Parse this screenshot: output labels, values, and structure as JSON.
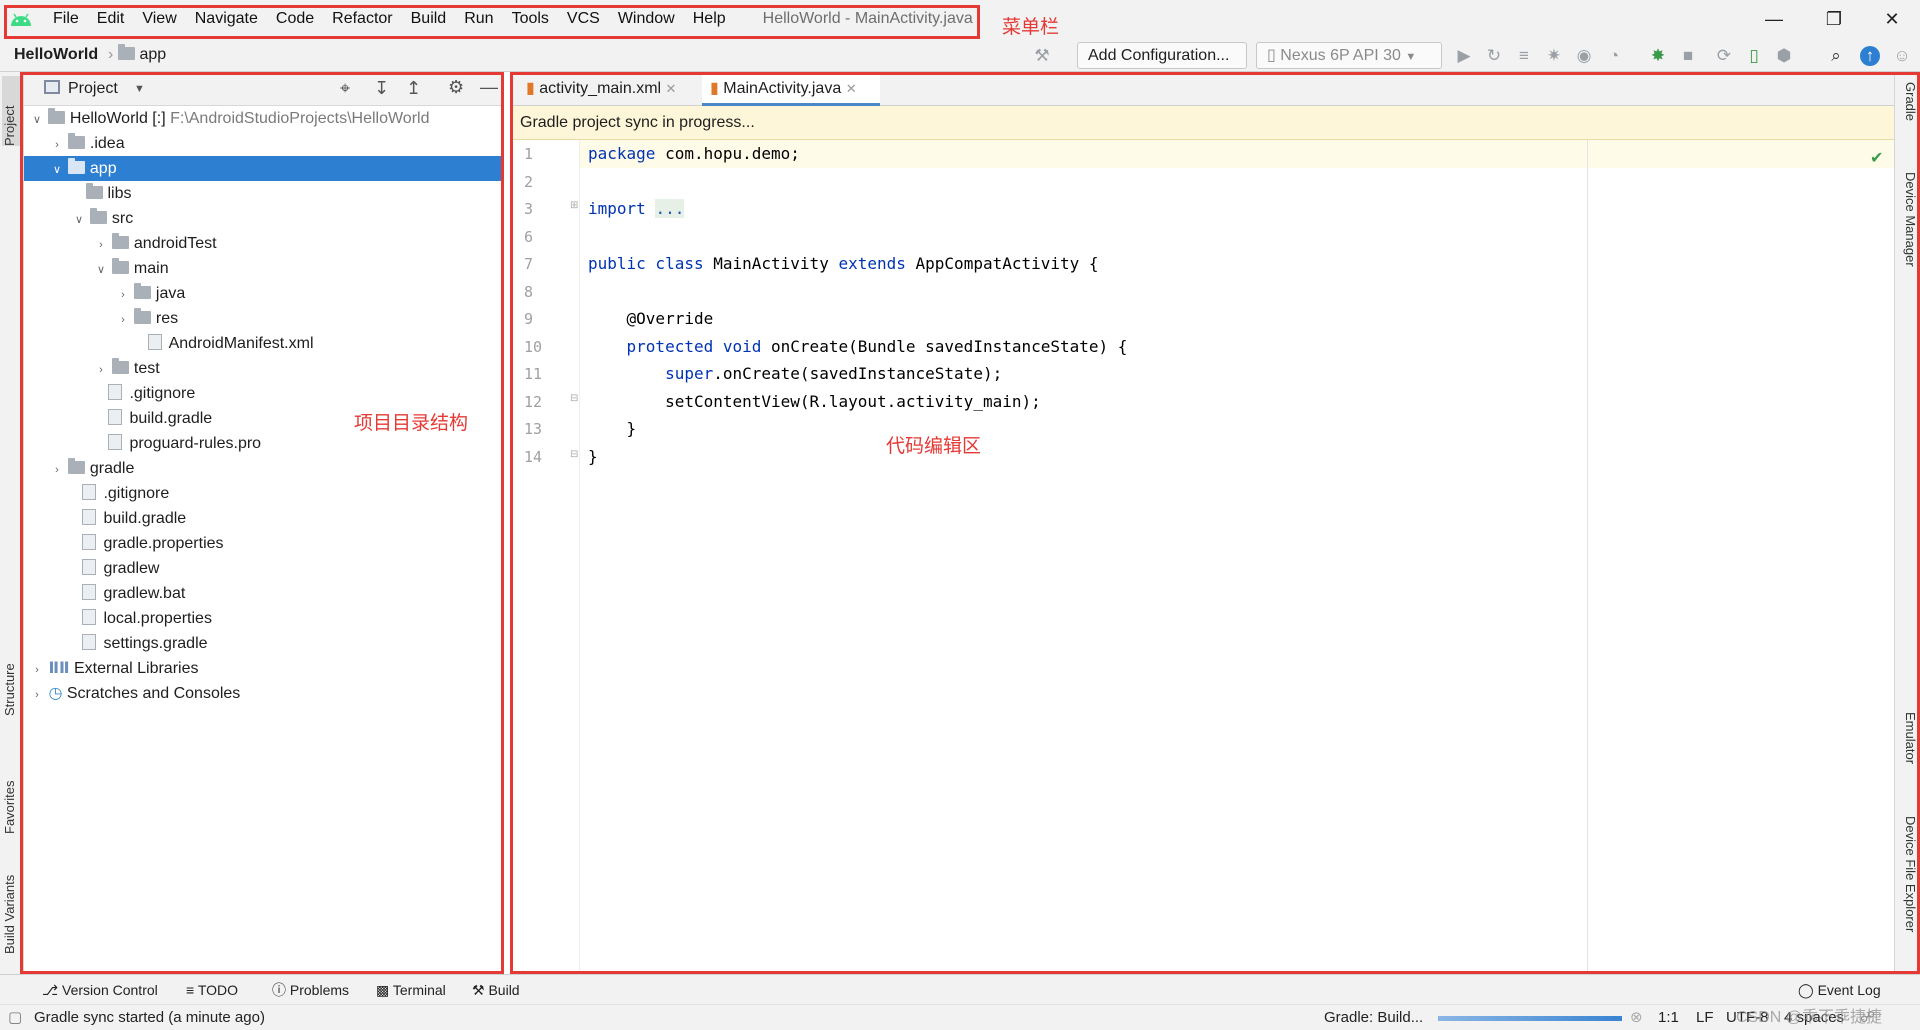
{
  "menubar": {
    "items": [
      "File",
      "Edit",
      "View",
      "Navigate",
      "Code",
      "Refactor",
      "Build",
      "Run",
      "Tools",
      "VCS",
      "Window",
      "Help"
    ],
    "title": "HelloWorld - MainActivity.java"
  },
  "navbar": {
    "project": "HelloWorld",
    "module": "app",
    "add_config": "Add Configuration...",
    "device": "Nexus 6P API 30"
  },
  "project_panel": {
    "header": "Project",
    "tree": [
      {
        "label": "HelloWorld [:]",
        "suffix": "F:\\AndroidStudioProjects\\HelloWorld"
      },
      {
        "label": ".idea"
      },
      {
        "label": "app"
      },
      {
        "label": "libs"
      },
      {
        "label": "src"
      },
      {
        "label": "androidTest"
      },
      {
        "label": "main"
      },
      {
        "label": "java"
      },
      {
        "label": "res"
      },
      {
        "label": "AndroidManifest.xml"
      },
      {
        "label": "test"
      },
      {
        "label": ".gitignore"
      },
      {
        "label": "build.gradle"
      },
      {
        "label": "proguard-rules.pro"
      },
      {
        "label": "gradle"
      },
      {
        "label": ".gitignore"
      },
      {
        "label": "build.gradle"
      },
      {
        "label": "gradle.properties"
      },
      {
        "label": "gradlew"
      },
      {
        "label": "gradlew.bat"
      },
      {
        "label": "local.properties"
      },
      {
        "label": "settings.gradle"
      },
      {
        "label": "External Libraries"
      },
      {
        "label": "Scratches and Consoles"
      }
    ]
  },
  "editor": {
    "tabs": [
      "activity_main.xml",
      "MainActivity.java"
    ],
    "banner": "Gradle project sync in progress...",
    "line_numbers": [
      "1",
      "2",
      "3",
      "6",
      "7",
      "8",
      "9",
      "10",
      "11",
      "12",
      "13",
      "14"
    ]
  },
  "left_stripe": [
    "Project",
    "Structure",
    "Favorites",
    "Build Variants"
  ],
  "right_stripe": [
    "Gradle",
    "Device Manager",
    "Emulator",
    "Device File Explorer"
  ],
  "bottom_tools": [
    "Version Control",
    "TODO",
    "Problems",
    "Terminal",
    "Build",
    "Event Log"
  ],
  "status": {
    "message": "Gradle sync started (a minute ago)",
    "progress_label": "Gradle: Build...",
    "position": "1:1",
    "line_sep": "LF",
    "encoding": "UTF-8",
    "indent": "4 spaces"
  },
  "annotations": {
    "menubar": "菜单栏",
    "project": "项目目录结构",
    "editor": "代码编辑区"
  },
  "watermark": "CSDN @乖不乖捷捷"
}
